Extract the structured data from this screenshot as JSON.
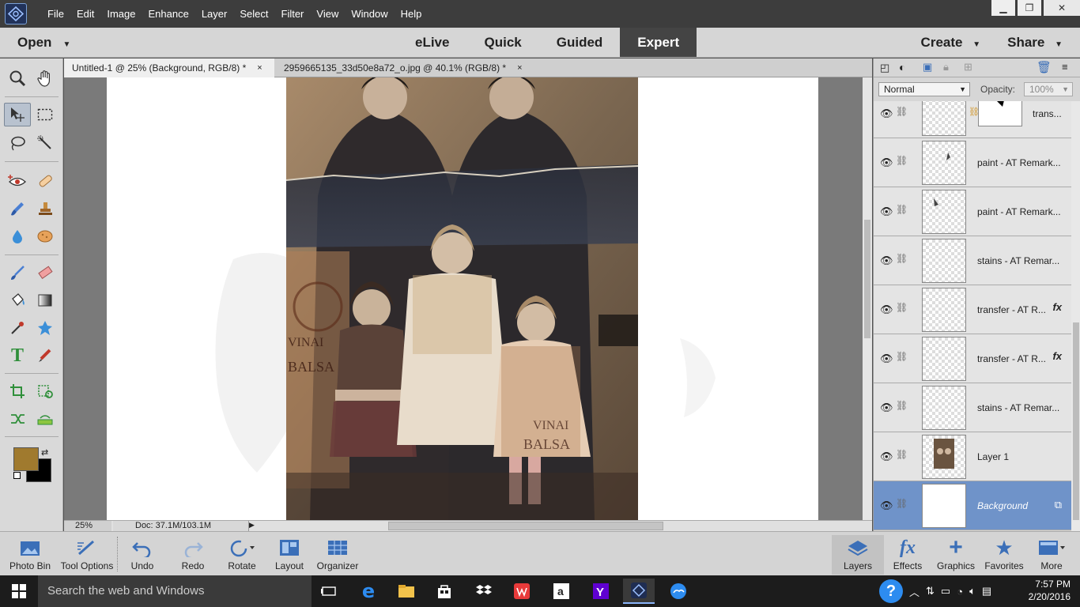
{
  "menubar": {
    "items": [
      "File",
      "Edit",
      "Image",
      "Enhance",
      "Layer",
      "Select",
      "Filter",
      "View",
      "Window",
      "Help"
    ]
  },
  "modebar": {
    "open_label": "Open",
    "modes": [
      "eLive",
      "Quick",
      "Guided",
      "Expert"
    ],
    "active_mode": "Expert",
    "create_label": "Create",
    "share_label": "Share"
  },
  "tabs": [
    {
      "label": "Untitled-1 @ 25% (Background, RGB/8) *",
      "close": "×"
    },
    {
      "label": "2959665135_33d50e8a72_o.jpg @ 40.1% (RGB/8) *",
      "close": "×"
    }
  ],
  "status": {
    "zoom": "25%",
    "doc": "Doc: 37.1M/103.1M"
  },
  "colors": {
    "foreground": "#a07a2e",
    "background": "#000000",
    "selected_layer": "#6f93c9"
  },
  "panel": {
    "blend_mode": "Normal",
    "opacity_label": "Opacity:",
    "opacity_value": "100%"
  },
  "layers": [
    {
      "name": "trans...",
      "fx": "",
      "has_mask": true
    },
    {
      "name": "paint - AT Remark...",
      "fx": ""
    },
    {
      "name": "paint - AT Remark...",
      "fx": ""
    },
    {
      "name": "stains - AT Remar...",
      "fx": ""
    },
    {
      "name": "transfer - AT R...",
      "fx": "fx"
    },
    {
      "name": "transfer - AT R...",
      "fx": "fx"
    },
    {
      "name": "stains - AT Remar...",
      "fx": ""
    },
    {
      "name": "Layer 1",
      "fx": ""
    },
    {
      "name": "Background",
      "fx": "",
      "selected": true
    }
  ],
  "bottombar": {
    "photo_bin": "Photo Bin",
    "tool_options": "Tool Options",
    "undo": "Undo",
    "redo": "Redo",
    "rotate": "Rotate",
    "layout": "Layout",
    "organizer": "Organizer",
    "layers": "Layers",
    "effects": "Effects",
    "graphics": "Graphics",
    "favorites": "Favorites",
    "more": "More"
  },
  "taskbar": {
    "search_placeholder": "Search the web and Windows",
    "time": "7:57 PM",
    "date": "2/20/2016"
  }
}
